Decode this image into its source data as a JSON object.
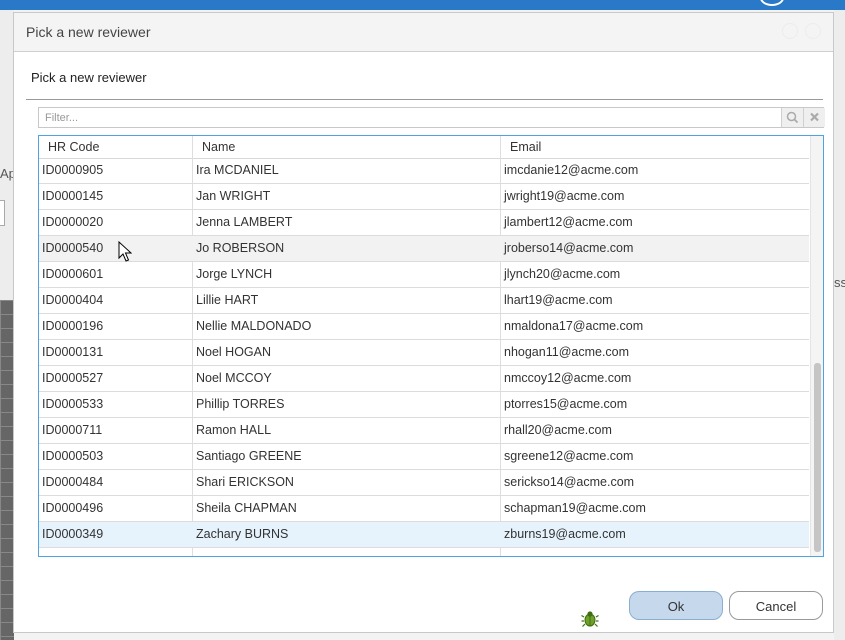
{
  "dialog": {
    "title": "Pick a new reviewer",
    "subtitle": "Pick a new reviewer"
  },
  "filter": {
    "placeholder": "Filter...",
    "search_icon": "search-icon",
    "clear_icon": "close-icon"
  },
  "grid": {
    "columns": [
      "HR Code",
      "Name",
      "Email"
    ],
    "rows": [
      {
        "code": "ID0000905",
        "name": "Ira MCDANIEL",
        "email": "imcdanie12@acme.com"
      },
      {
        "code": "ID0000145",
        "name": "Jan WRIGHT",
        "email": "jwright19@acme.com"
      },
      {
        "code": "ID0000020",
        "name": "Jenna LAMBERT",
        "email": "jlambert12@acme.com"
      },
      {
        "code": "ID0000540",
        "name": "Jo ROBERSON",
        "email": "jroberso14@acme.com"
      },
      {
        "code": "ID0000601",
        "name": "Jorge LYNCH",
        "email": "jlynch20@acme.com"
      },
      {
        "code": "ID0000404",
        "name": "Lillie HART",
        "email": "lhart19@acme.com"
      },
      {
        "code": "ID0000196",
        "name": "Nellie MALDONADO",
        "email": "nmaldona17@acme.com"
      },
      {
        "code": "ID0000131",
        "name": "Noel HOGAN",
        "email": "nhogan11@acme.com"
      },
      {
        "code": "ID0000527",
        "name": "Noel MCCOY",
        "email": "nmccoy12@acme.com"
      },
      {
        "code": "ID0000533",
        "name": "Phillip TORRES",
        "email": "ptorres15@acme.com"
      },
      {
        "code": "ID0000711",
        "name": "Ramon HALL",
        "email": "rhall20@acme.com"
      },
      {
        "code": "ID0000503",
        "name": "Santiago GREENE",
        "email": "sgreene12@acme.com"
      },
      {
        "code": "ID0000484",
        "name": "Shari ERICKSON",
        "email": "sericksо14@acme.com"
      },
      {
        "code": "ID0000496",
        "name": "Sheila CHAPMAN",
        "email": "schapman19@acme.com"
      },
      {
        "code": "ID0000349",
        "name": "Zachary BURNS",
        "email": "zburns19@acme.com"
      }
    ],
    "hover_row": 3,
    "selected_row": 14
  },
  "buttons": {
    "ok": "Ok",
    "cancel": "Cancel"
  },
  "background": {
    "left_text": "App",
    "right_text": "ss"
  },
  "colors": {
    "accent": "#2a78c8",
    "grid_border": "#4fa3e0",
    "selected_row": "#e6f3fc",
    "ok_button": "#c5d8ec"
  }
}
